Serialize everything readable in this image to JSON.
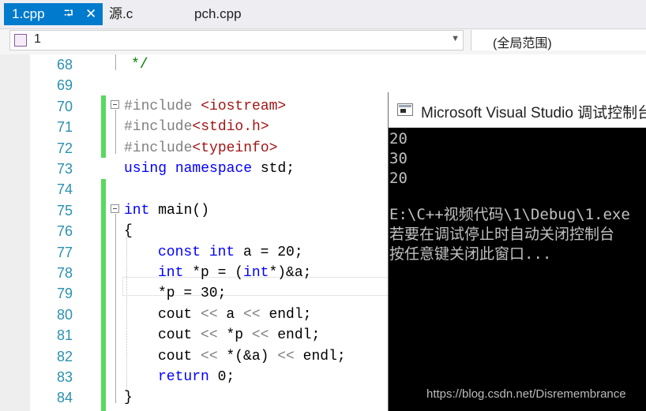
{
  "tabs": {
    "active": {
      "label": "1.cpp",
      "pin": "⮒",
      "close": "✕"
    },
    "others": [
      "源.c",
      "pch.cpp"
    ]
  },
  "navbar": {
    "scope_left": "1",
    "scope_right": "(全局范围)"
  },
  "editor": {
    "line_numbers": [
      "68",
      "69",
      "70",
      "71",
      "72",
      "73",
      "74",
      "75",
      "76",
      "77",
      "78",
      "79",
      "80",
      "81",
      "82",
      "83",
      "84"
    ],
    "lines": {
      "l68_comment": "*/",
      "l70_pp": "#include ",
      "l70_inc": "<iostream>",
      "l71_pp": "#include",
      "l71_inc": "<stdio.h>",
      "l72_pp": "#include",
      "l72_inc": "<typeinfo>",
      "l73_kw1": "using",
      "l73_kw2": "namespace",
      "l73_rest": " std;",
      "l75_kw": "int",
      "l75_rest": " main()",
      "l76": "{",
      "l77_kw1": "const",
      "l77_kw2": "int",
      "l77_rest": " a = 20;",
      "l78_kw1": "int",
      "l78_mid": " *p = (",
      "l78_kw2": "int",
      "l78_rest": "*)&a;",
      "l79": "*p = 30;",
      "l80_a": "cout ",
      "l80_op1": "<<",
      "l80_b": " a ",
      "l80_op2": "<<",
      "l80_c": " endl;",
      "l81_a": "cout ",
      "l81_op1": "<<",
      "l81_b": " *p ",
      "l81_op2": "<<",
      "l81_c": " endl;",
      "l82_a": "cout ",
      "l82_op1": "<<",
      "l82_b": " *(&a) ",
      "l82_op2": "<<",
      "l82_c": " endl;",
      "l83_kw": "return",
      "l83_rest": " 0;",
      "l84": "}"
    }
  },
  "console": {
    "title": "Microsoft Visual Studio 调试控制台",
    "output": [
      "20",
      "30",
      "20",
      "",
      "E:\\C++视频代码\\1\\Debug\\1.exe",
      "若要在调试停止时自动关闭控制台",
      "按任意键关闭此窗口..."
    ]
  },
  "watermark": "https://blog.csdn.net/Disremembrance",
  "colors": {
    "accent": "#007acc",
    "keyword": "#0000ff",
    "include": "#a31515",
    "preprocessor": "#808080",
    "line_number": "#2b91af",
    "change_margin": "#57d95e",
    "console_bg": "#000000",
    "console_text": "#c0c0c0"
  }
}
